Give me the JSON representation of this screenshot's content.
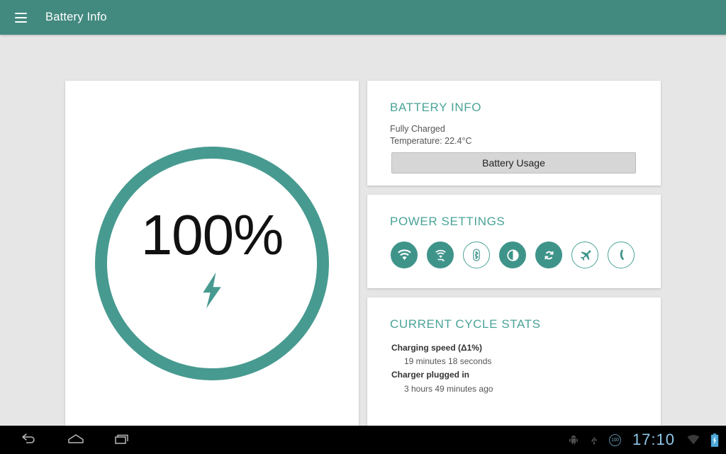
{
  "app_bar": {
    "menu_icon": "hamburger-menu-icon",
    "title": "Battery Info",
    "background_color": "#42897f"
  },
  "gauge": {
    "percent_label": "100%",
    "percent_value": 100,
    "ring_color": "#479a90",
    "charging_icon": "lightning-bolt-icon",
    "charging": true
  },
  "battery_info": {
    "title": "BATTERY INFO",
    "status": "Fully Charged",
    "temperature": "Temperature: 22.4°C",
    "usage_button": "Battery Usage"
  },
  "power_settings": {
    "title": "POWER SETTINGS",
    "toggles": [
      {
        "name": "wifi-icon",
        "label": "Wi-Fi",
        "state": "on"
      },
      {
        "name": "hotspot-icon",
        "label": "Hotspot",
        "state": "on"
      },
      {
        "name": "bluetooth-icon",
        "label": "Bluetooth",
        "state": "off"
      },
      {
        "name": "brightness-icon",
        "label": "Brightness",
        "state": "on"
      },
      {
        "name": "sync-icon",
        "label": "Auto Sync",
        "state": "on"
      },
      {
        "name": "airplane-icon",
        "label": "Airplane Mode",
        "state": "off"
      },
      {
        "name": "night-mode-icon",
        "label": "Night Mode",
        "state": "off"
      }
    ]
  },
  "cycle_stats": {
    "title": "CURRENT CYCLE STATS",
    "rows": [
      {
        "label": "Charging speed (Δ1%)",
        "value": "19 minutes 18 seconds"
      },
      {
        "label": "Charger plugged in",
        "value": "3 hours 49 minutes ago"
      }
    ]
  },
  "system_nav": {
    "buttons": [
      {
        "name": "back-button",
        "label": "Back"
      },
      {
        "name": "home-button",
        "label": "Home"
      },
      {
        "name": "recents-button",
        "label": "Recents"
      }
    ],
    "status": {
      "debug_icon": "android-debug-icon",
      "usb_icon": "usb-icon",
      "battery_percent": "100",
      "clock": "17:10",
      "wifi_icon": "wifi-signal-icon",
      "battery_icon": "battery-charging-icon",
      "accent_color": "#8fc7e8"
    }
  },
  "theme": {
    "background": "#e6e6e6",
    "card_background": "#ffffff",
    "accent": "#4aa398"
  }
}
